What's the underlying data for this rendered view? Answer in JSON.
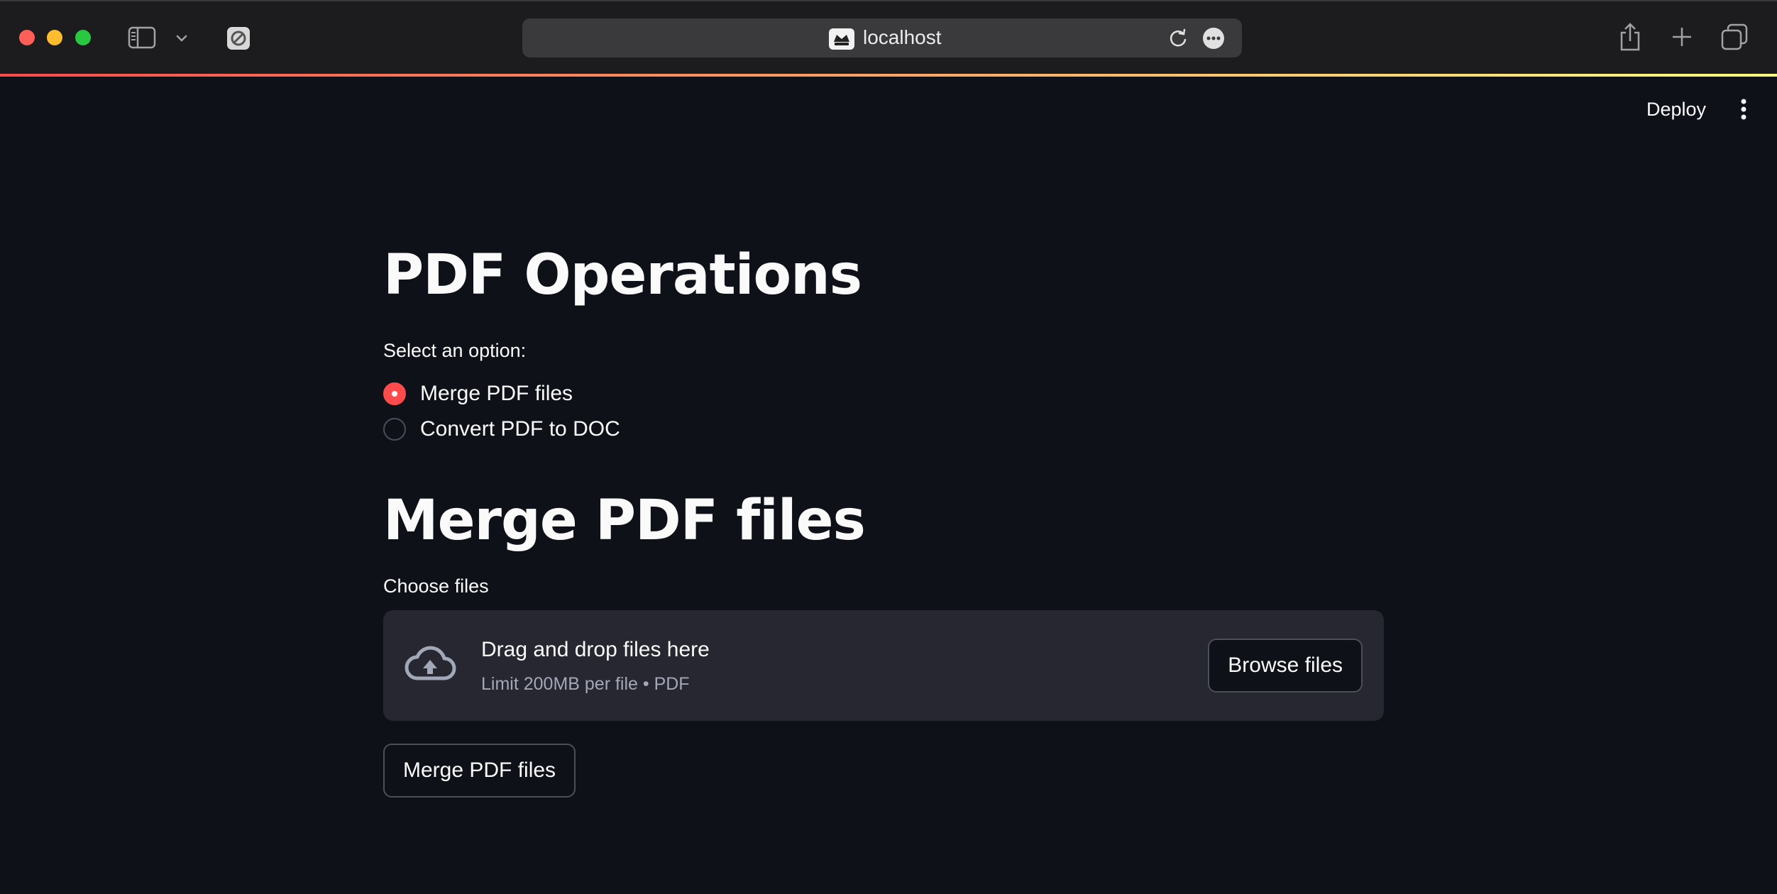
{
  "browser": {
    "url": "localhost",
    "icons": [
      "sidebar-icon",
      "chevron-down-icon",
      "extension-icon",
      "streamlit-icon",
      "reload-icon",
      "more-icon",
      "share-icon",
      "plus-icon",
      "tabs-icon"
    ]
  },
  "header": {
    "deploy_label": "Deploy"
  },
  "page": {
    "title": "PDF Operations",
    "select_label": "Select an option:",
    "options": [
      {
        "label": "Merge PDF files",
        "selected": true
      },
      {
        "label": "Convert PDF to DOC",
        "selected": false
      }
    ],
    "section_title": "Merge PDF files",
    "uploader": {
      "label": "Choose files",
      "drop_text": "Drag and drop files here",
      "limit_text": "Limit 200MB per file • PDF",
      "browse_label": "Browse files"
    },
    "action_button": "Merge PDF files"
  },
  "colors": {
    "accent": "#ff4b4b",
    "background": "#0e1117",
    "dropzone": "#262730"
  }
}
